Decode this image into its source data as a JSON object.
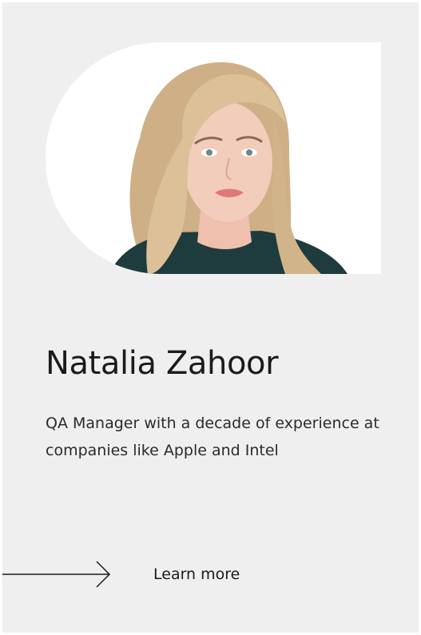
{
  "profile": {
    "name": "Natalia Zahoor",
    "bio": "QA Manager with a decade of experience at companies like Apple and Intel",
    "photo_icon": "portrait-photo"
  },
  "cta": {
    "label": "Learn more",
    "icon": "arrow-right-icon"
  },
  "colors": {
    "card_background": "#efefef",
    "photo_background": "#ffffff",
    "text": "#1b1b1b",
    "hair": "#d9bd92",
    "skin": "#f3cdbb",
    "lips": "#e07878",
    "top": "#1e3b3d"
  }
}
